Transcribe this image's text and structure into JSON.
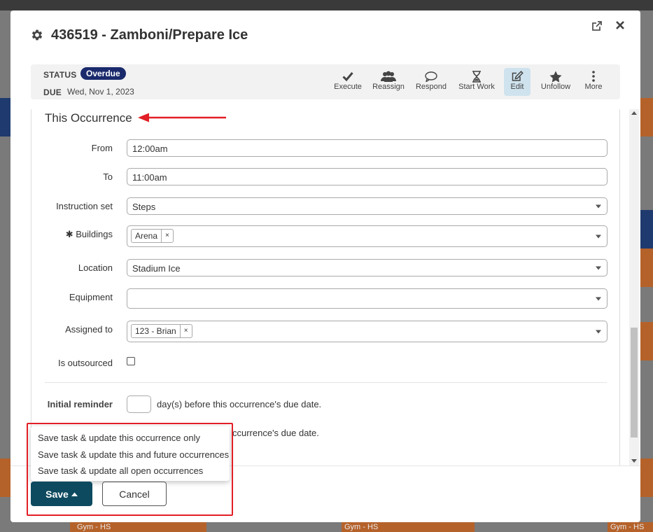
{
  "modal": {
    "title": "436519 - Zamboni/Prepare Ice"
  },
  "status": {
    "status_label": "STATUS",
    "status_value": "Overdue",
    "due_label": "DUE",
    "due_value": "Wed, Nov 1, 2023"
  },
  "toolbar": [
    {
      "label": "Execute",
      "icon": "check-icon"
    },
    {
      "label": "Reassign",
      "icon": "users-icon"
    },
    {
      "label": "Respond",
      "icon": "comment-icon"
    },
    {
      "label": "Start Work",
      "icon": "hourglass-icon"
    },
    {
      "label": "Edit",
      "icon": "edit-icon",
      "active": true
    },
    {
      "label": "Unfollow",
      "icon": "star-icon"
    },
    {
      "label": "More",
      "icon": "more-vertical-icon"
    }
  ],
  "form": {
    "section_title": "This Occurrence",
    "from_label": "From",
    "from_value": "12:00am",
    "to_label": "To",
    "to_value": "11:00am",
    "instruction_label": "Instruction set",
    "instruction_value": "Steps",
    "buildings_label": "Buildings",
    "buildings_required": "✱",
    "buildings_chip": "Arena",
    "location_label": "Location",
    "location_value": "Stadium Ice",
    "equipment_label": "Equipment",
    "equipment_value": "",
    "assigned_label": "Assigned to",
    "assigned_chip": "123 - Brian",
    "outsourced_label": "Is outsourced",
    "chip_remove": "×",
    "initial_reminder_label": "Initial reminder",
    "initial_reminder_suffix": "day(s) before this occurrence's due date.",
    "second_reminder_suffix": "ccurrence's due date."
  },
  "save_menu": {
    "items": [
      "Save task & update this occurrence only",
      "Save task & update this and future occurrences",
      "Save task & update all open occurrences"
    ]
  },
  "footer": {
    "save_label": "Save",
    "cancel_label": "Cancel"
  },
  "background": {
    "gym_label": "Gym - HS"
  },
  "colors": {
    "primary": "#0d4a5f",
    "badge": "#1a2a6c",
    "annotation_red": "#e21f26",
    "active_tool": "#cfe3ee"
  }
}
